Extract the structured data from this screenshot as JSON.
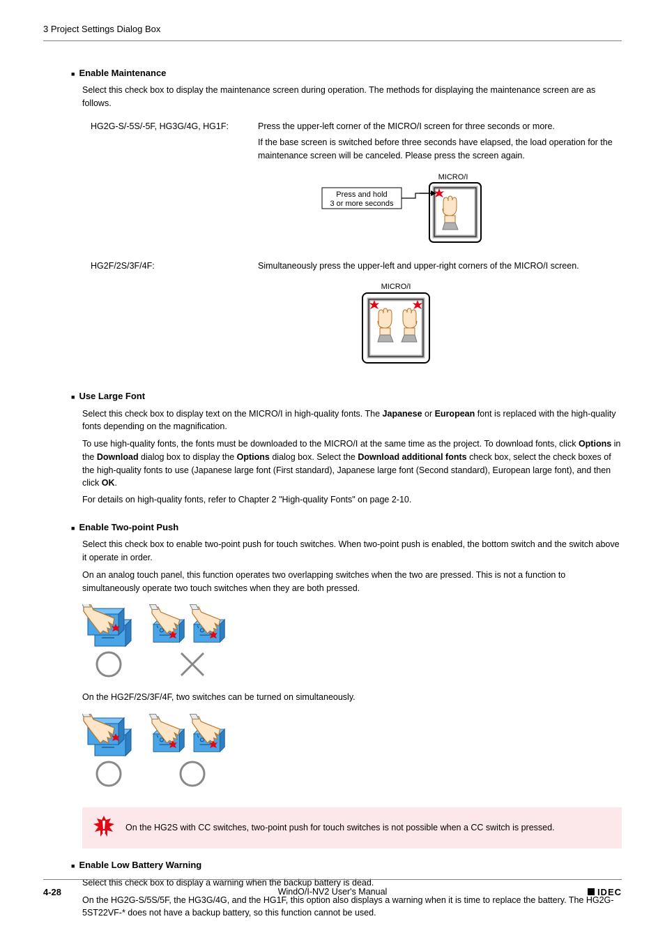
{
  "header": {
    "title": "3 Project Settings Dialog Box"
  },
  "sections": {
    "enableMaintenance": {
      "title": "Enable Maintenance",
      "intro": "Select this check box to display the maintenance screen during operation. The methods for displaying the maintenance screen are as follows.",
      "row1": {
        "label": "HG2G-S/-5S/-5F, HG3G/4G, HG1F:",
        "p1": "Press the upper-left corner of the MICRO/I screen for three seconds or more.",
        "p2": "If the base screen is switched before three seconds have elapsed, the load operation for the maintenance screen will be canceled. Please press the screen again."
      },
      "row2": {
        "label": "HG2F/2S/3F/4F:",
        "p1": "Simultaneously press the upper-left and upper-right corners of the MICRO/I screen."
      },
      "fig1": {
        "deviceLabel": "MICRO/I",
        "boxLine1": "Press and hold",
        "boxLine2": "3 or more seconds"
      },
      "fig2": {
        "deviceLabel": "MICRO/I"
      }
    },
    "useLargeFont": {
      "title": "Use Large Font",
      "p1a": "Select this check box to display text on the MICRO/I in high-quality fonts. The ",
      "p1b_bold": "Japanese",
      "p1c": " or ",
      "p1d_bold": "European",
      "p1e": " font is replaced with the high-quality fonts depending on the magnification.",
      "p2a": "To use high-quality fonts, the fonts must be downloaded to the MICRO/I at the same time as the project. To download fonts, click ",
      "p2b_bold": "Options",
      "p2c": " in the ",
      "p2d_bold": "Download",
      "p2e": " dialog box to display the ",
      "p2f_bold": "Options",
      "p2g": " dialog box. Select the ",
      "p2h_bold": "Download additional fonts",
      "p2i": " check box, select the check boxes of the high-quality fonts to use (Japanese large font (First standard), Japanese large font (Second standard), European large font), and then click ",
      "p2j_bold": "OK",
      "p2k": ".",
      "p3": "For details on high-quality fonts, refer to Chapter 2 \"High-quality Fonts\" on page 2-10."
    },
    "enableTwoPoint": {
      "title": "Enable Two-point Push",
      "p1": "Select this check box to enable two-point push for touch switches. When two-point push is enabled, the bottom switch and the switch above it operate in order.",
      "p2": "On an analog touch panel, this function operates two overlapping switches when the two are pressed. This is not a function to simultaneously operate two touch switches when they are both pressed.",
      "p3": "On the HG2F/2S/3F/4F, two switches can be turned on simultaneously.",
      "warning": "On the HG2S with CC switches, two-point push for touch switches is not possible when a CC switch is pressed."
    },
    "enableLowBattery": {
      "title": "Enable Low Battery Warning",
      "p1": "Select this check box to display a warning when the backup battery is dead.",
      "p2": "On the HG2G-S/5S/5F, the HG3G/4G, and the HG1F, this option also displays a warning when it is time to replace the battery. The HG2G-5ST22VF-* does not have a backup battery, so this function cannot be used."
    }
  },
  "footer": {
    "pageNum": "4-28",
    "center": "WindO/I-NV2 User's Manual",
    "logo": "IDEC"
  }
}
